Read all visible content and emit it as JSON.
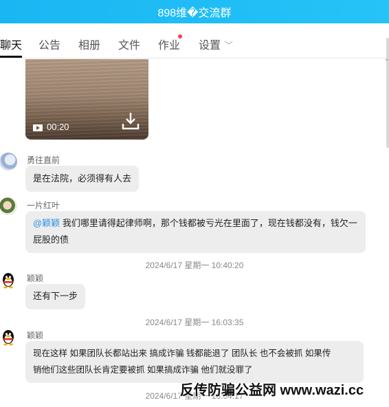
{
  "window": {
    "title": "898维�交流群"
  },
  "tabs": [
    {
      "label": "聊天",
      "active": true
    },
    {
      "label": "公告"
    },
    {
      "label": "相册"
    },
    {
      "label": "文件"
    },
    {
      "label": "作业",
      "has_notification_dot": true
    },
    {
      "label": "设置",
      "has_dropdown": true
    }
  ],
  "video": {
    "duration": "00:20",
    "play_icon": "video-icon",
    "download_icon": "download-icon"
  },
  "messages": [
    {
      "sender": "勇往直前",
      "text": "是在法院，必须得有人去"
    },
    {
      "sender": "一片红叶",
      "mention": "@颖颖",
      "text_line1": " 我们哪里请得起律师啊，那个钱都被亏光在里面了，现在钱都没有，钱欠一",
      "text_line2": "屁股的债"
    },
    {
      "timestamp": "2024/6/17 星期一 10:40:20"
    },
    {
      "sender": "颖颖",
      "text": "还有下一步"
    },
    {
      "timestamp": "2024/6/17 星期一 16:03:35"
    },
    {
      "sender": "颖颖",
      "text_line1": "现在这样  如果团队长都站出来 搞成诈骗  钱都能退了  团队长  也不会被抓 如果传",
      "text_line2": "销他们这些团队长肯定要被抓  如果搞成诈骗 他们就没罪了"
    },
    {
      "timestamp": "2024/6/17 星期一 16:04:17"
    }
  ],
  "watermark": "反传防骗公益网 www.wazi.cc",
  "colors": {
    "titlebar": "#19b6f3",
    "mention": "#2b8ee6",
    "notification_dot": "#f5434a",
    "bubble": "#ededed"
  }
}
